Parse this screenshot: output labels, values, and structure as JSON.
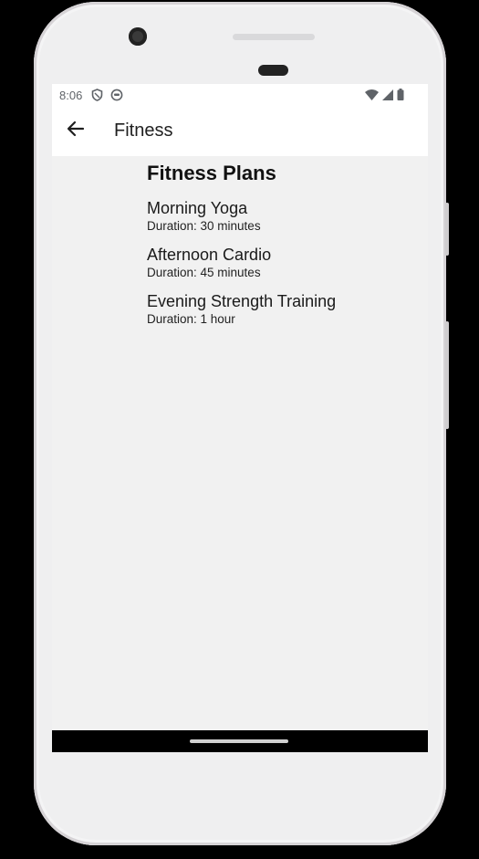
{
  "status_bar": {
    "time": "8:06",
    "icons": [
      "shield-icon",
      "robot-icon"
    ],
    "right_icons": [
      "wifi-icon",
      "signal-icon",
      "battery-icon"
    ]
  },
  "app_bar": {
    "back_icon": "arrow-left-icon",
    "title": "Fitness"
  },
  "main": {
    "section_title": "Fitness Plans",
    "plans": [
      {
        "name": "Morning Yoga",
        "duration": "Duration: 30 minutes"
      },
      {
        "name": "Afternoon Cardio",
        "duration": "Duration: 45 minutes"
      },
      {
        "name": "Evening Strength Training",
        "duration": "Duration: 1 hour"
      }
    ]
  },
  "colors": {
    "background": "#f1f1f1",
    "app_bar": "#ffffff",
    "text": "#1a1a1a"
  }
}
